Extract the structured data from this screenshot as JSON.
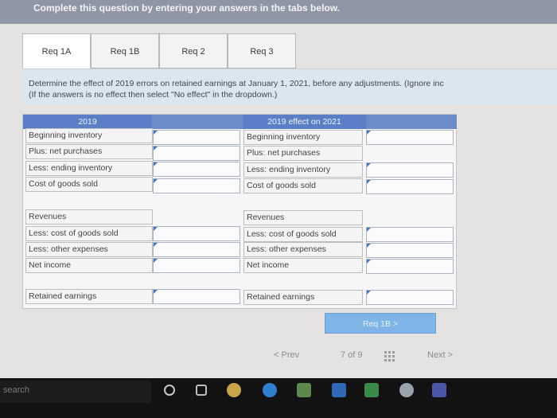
{
  "header": {
    "instruction": "Complete this question by entering your answers in the tabs below."
  },
  "tabs": [
    {
      "label": "Req 1A"
    },
    {
      "label": "Req 1B"
    },
    {
      "label": "Req 2"
    },
    {
      "label": "Req 3"
    }
  ],
  "question": {
    "line1": "Determine the effect of 2019 errors on retained earnings at January 1, 2021, before any adjustments. (Ignore inc",
    "line2": "(If the answers is no effect then select \"No effect\" in the dropdown.)"
  },
  "table": {
    "left_header": "2019",
    "right_header": "2019 effect on 2021",
    "left_rows": [
      "Beginning inventory",
      "Plus: net purchases",
      "Less: ending inventory",
      "Cost of goods sold",
      "Revenues",
      "Less: cost of goods sold",
      "Less: other expenses",
      "Net income",
      "Retained earnings"
    ],
    "right_rows": [
      "Beginning inventory",
      "Plus: net purchases",
      "Less: ending inventory",
      "Cost of goods sold",
      "Revenues",
      "Less: cost of goods sold",
      "Less: other expenses",
      "Net income",
      "Retained earnings"
    ]
  },
  "navigation": {
    "req_button": "Req 1B  >",
    "prev": "< Prev",
    "page": "7 of 9",
    "next": "Next >"
  },
  "taskbar": {
    "search_placeholder": "search",
    "icons": [
      "cortana-icon",
      "task-view-icon",
      "chrome-icon",
      "edge-icon",
      "minecraft-icon",
      "mail-icon",
      "office-icon",
      "globe-icon",
      "teams-icon"
    ]
  }
}
